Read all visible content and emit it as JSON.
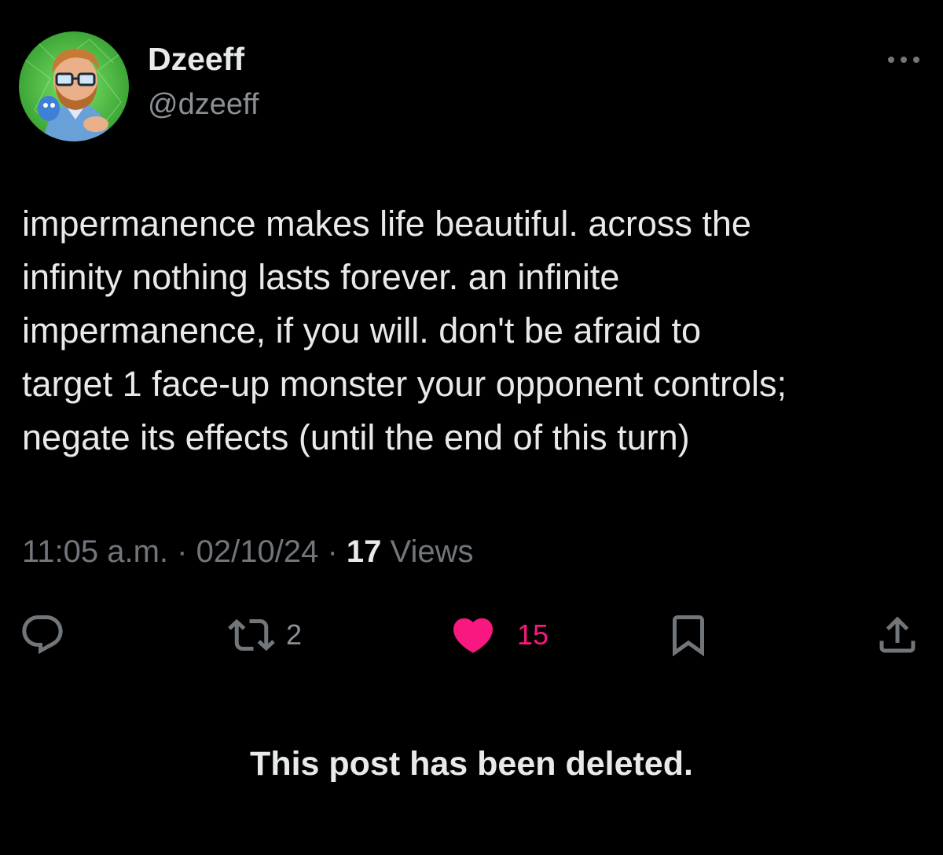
{
  "author": {
    "display_name": "Dzeeff",
    "handle": "@dzeeff",
    "avatar_icon": "avatar-illustration-icon"
  },
  "more_icon": "more-horizontal-icon",
  "post": {
    "text_lines": [
      "impermanence makes life beautiful. across the",
      "infinity nothing lasts forever. an infinite",
      "impermanence, if you will. don't be afraid to",
      "target 1 face-up monster your opponent controls;",
      "negate its effects (until the end of this turn)"
    ],
    "time": "11:05 a.m.",
    "separator": "·",
    "date": "02/10/24",
    "views_count": "17",
    "views_label": "Views"
  },
  "actions": {
    "reply": {
      "icon": "reply-icon"
    },
    "repost": {
      "icon": "repost-icon",
      "count": "2"
    },
    "like": {
      "icon": "heart-icon",
      "count": "15",
      "liked": true
    },
    "bookmark": {
      "icon": "bookmark-icon"
    },
    "share": {
      "icon": "share-icon"
    }
  },
  "deleted_notice": "This post has been deleted.",
  "colors": {
    "background": "#000000",
    "text_primary": "#e7e9ea",
    "text_secondary": "#71767b",
    "like_active": "#f91880"
  }
}
